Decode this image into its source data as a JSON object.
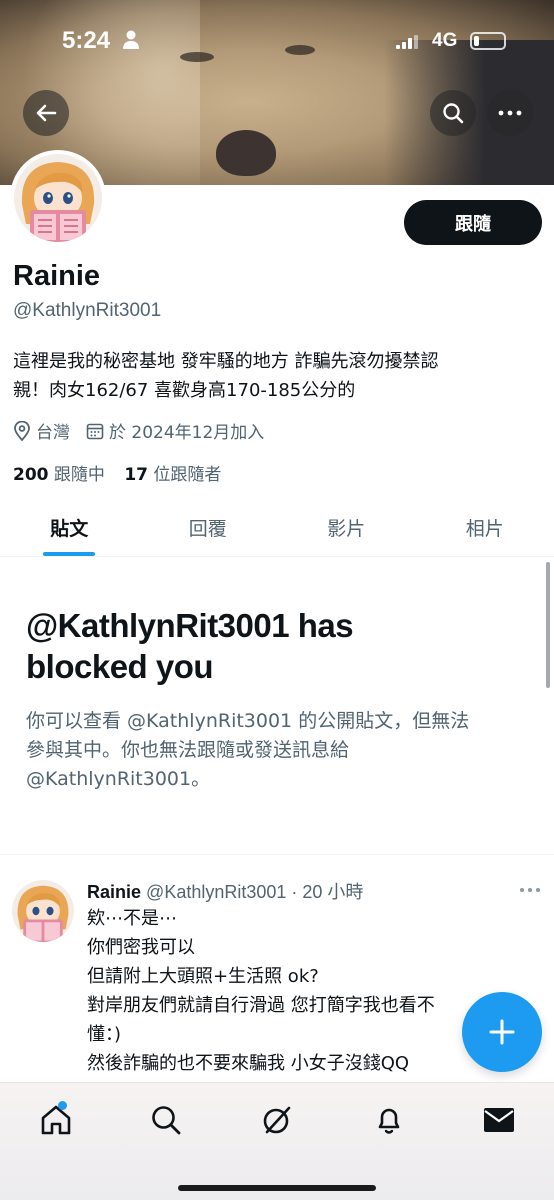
{
  "status_bar": {
    "time": "5:24",
    "network": "4G"
  },
  "profile": {
    "display_name": "Rainie",
    "handle": "@KathlynRit3001",
    "bio_line1": "這裡是我的秘密基地 發牢騷的地方 詐騙先滾勿擾禁認",
    "bio_line2": "親！肉女162/67 喜歡身高170-185公分的",
    "location": "台灣",
    "joined": "於 2024年12月加入",
    "following_count": "200",
    "following_label": "跟隨中",
    "followers_count": "17",
    "followers_label": "位跟隨者",
    "follow_button": "跟隨"
  },
  "tabs": [
    {
      "label": "貼文",
      "active": true
    },
    {
      "label": "回覆",
      "active": false
    },
    {
      "label": "影片",
      "active": false
    },
    {
      "label": "相片",
      "active": false
    }
  ],
  "blocked": {
    "title_line1": "@KathlynRit3001 has",
    "title_line2": "blocked you",
    "desc_line1": "你可以查看 @KathlynRit3001 的公開貼文，但無法",
    "desc_line2": "參與其中。你也無法跟隨或發送訊息給",
    "desc_line3": "@KathlynRit3001。"
  },
  "tweet": {
    "name": "Rainie",
    "handle_time": "@KathlynRit3001 · 20 小時",
    "lines": [
      "欸⋯不是⋯",
      "你們密我可以",
      "但請附上大頭照+生活照 ok?",
      "對岸朋友們就請自行滑過 您打簡字我也看不",
      "懂：)",
      "然後詐騙的也不要來騙我 小女子沒錢QQ"
    ]
  },
  "icons": {
    "back": "arrow-left-icon",
    "search": "search-icon",
    "more": "more-horizontal-icon",
    "location": "location-pin-icon",
    "calendar": "calendar-icon",
    "compose": "plus-icon",
    "nav": [
      "home-icon",
      "search-icon",
      "grok-icon",
      "bell-icon",
      "mail-icon"
    ]
  },
  "colors": {
    "accent": "#1d9bf0",
    "text": "#0f1419",
    "secondary": "#536471"
  }
}
